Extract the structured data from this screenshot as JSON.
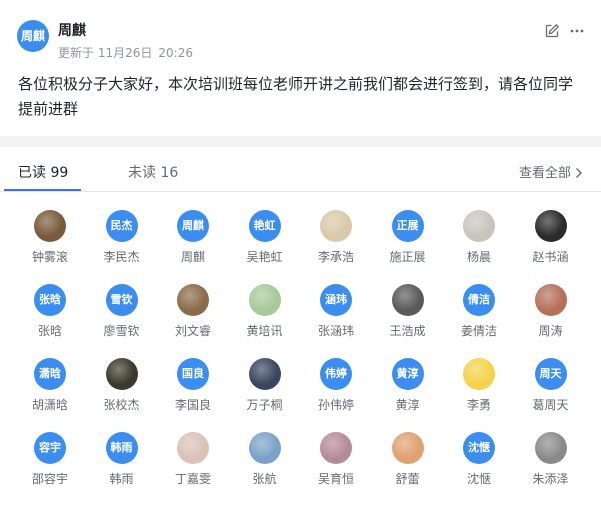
{
  "author": {
    "avatar_text": "周麒",
    "name": "周麒",
    "updated_label": "更新于",
    "updated_date": "11月26日",
    "updated_time": "20:26"
  },
  "message": "各位积极分子大家好，本次培训班每位老师开讲之前我们都会进行签到，请各位同学提前进群",
  "tabs": {
    "read": "已读 99",
    "unread": "未读 16",
    "view_all": "查看全部"
  },
  "readers": [
    {
      "name": "钟雾滚",
      "avatar_text": "",
      "bg": "#7a5a3a"
    },
    {
      "name": "李民杰",
      "avatar_text": "民杰",
      "bg": "#3b8ef0"
    },
    {
      "name": "周麒",
      "avatar_text": "周麒",
      "bg": "#3b8ef0"
    },
    {
      "name": "吴艳虹",
      "avatar_text": "艳虹",
      "bg": "#3b8ef0"
    },
    {
      "name": "李承浩",
      "avatar_text": "",
      "bg": "#d8c9a8"
    },
    {
      "name": "施正展",
      "avatar_text": "正展",
      "bg": "#3b8ef0"
    },
    {
      "name": "杨晨",
      "avatar_text": "",
      "bg": "#c9c4be"
    },
    {
      "name": "赵书涵",
      "avatar_text": "",
      "bg": "#2b2b2b"
    },
    {
      "name": "张晗",
      "avatar_text": "张晗",
      "bg": "#3b8ef0"
    },
    {
      "name": "廖雪钦",
      "avatar_text": "雪钦",
      "bg": "#3b8ef0"
    },
    {
      "name": "刘文睿",
      "avatar_text": "",
      "bg": "#8a6b4a"
    },
    {
      "name": "黄培讯",
      "avatar_text": "",
      "bg": "#a8c99a"
    },
    {
      "name": "张涵玮",
      "avatar_text": "涵玮",
      "bg": "#3b8ef0"
    },
    {
      "name": "王浩成",
      "avatar_text": "",
      "bg": "#5a5a5a"
    },
    {
      "name": "姜倩洁",
      "avatar_text": "倩洁",
      "bg": "#3b8ef0"
    },
    {
      "name": "周涛",
      "avatar_text": "",
      "bg": "#b5705a"
    },
    {
      "name": "胡潇晗",
      "avatar_text": "潇晗",
      "bg": "#3b8ef0"
    },
    {
      "name": "张校杰",
      "avatar_text": "",
      "bg": "#3a3a2a"
    },
    {
      "name": "李国良",
      "avatar_text": "国良",
      "bg": "#3b8ef0"
    },
    {
      "name": "万子桐",
      "avatar_text": "",
      "bg": "#3a4660"
    },
    {
      "name": "孙伟婷",
      "avatar_text": "伟婷",
      "bg": "#3b8ef0"
    },
    {
      "name": "黄淳",
      "avatar_text": "黄淳",
      "bg": "#3b8ef0"
    },
    {
      "name": "李勇",
      "avatar_text": "",
      "bg": "#f4d34a"
    },
    {
      "name": "葛周天",
      "avatar_text": "周天",
      "bg": "#3b8ef0"
    },
    {
      "name": "邵容宇",
      "avatar_text": "容宇",
      "bg": "#3b8ef0"
    },
    {
      "name": "韩雨",
      "avatar_text": "韩雨",
      "bg": "#3b8ef0"
    },
    {
      "name": "丁嘉雯",
      "avatar_text": "",
      "bg": "#d9c2b8"
    },
    {
      "name": "张航",
      "avatar_text": "",
      "bg": "#7aa2c8"
    },
    {
      "name": "吴育恒",
      "avatar_text": "",
      "bg": "#b58a98"
    },
    {
      "name": "舒蕾",
      "avatar_text": "",
      "bg": "#e0a070"
    },
    {
      "name": "沈惬",
      "avatar_text": "沈惬",
      "bg": "#3b8ef0"
    },
    {
      "name": "朱添泽",
      "avatar_text": "",
      "bg": "#8a8a8a"
    }
  ]
}
